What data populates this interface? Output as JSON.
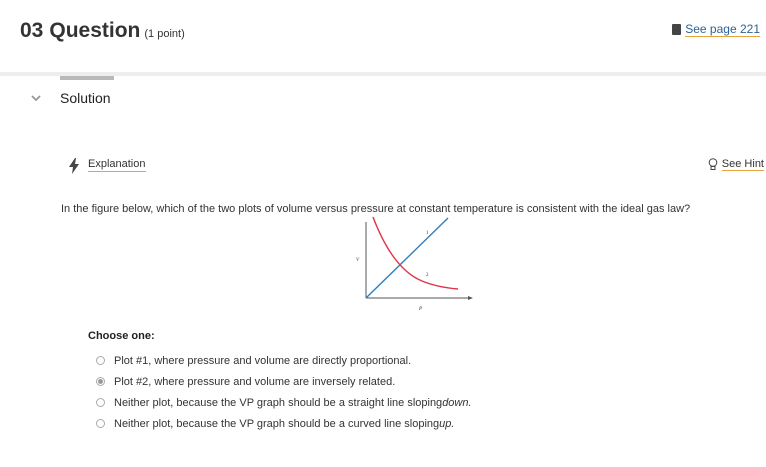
{
  "header": {
    "question_number": "03",
    "question_label": "Question",
    "points": "(1 point)",
    "see_page": "See page 221"
  },
  "solution": {
    "label": "Solution"
  },
  "explanation": {
    "link": "Explanation",
    "hint": "See Hint"
  },
  "question_text": "In the figure below, which of the two plots of volume versus pressure at constant temperature is consistent with the ideal gas law?",
  "figure": {
    "y_axis_label": "V",
    "x_axis_label": "P",
    "line_labels": [
      "1",
      "2"
    ],
    "colors": {
      "plot1": "#2f7fc1",
      "plot2": "#e0344a",
      "axes": "#555555"
    }
  },
  "choices": {
    "prompt": "Choose one:",
    "options": [
      {
        "text": "Plot #1, where pressure and volume are directly proportional.",
        "suffix": "",
        "selected": false
      },
      {
        "text": "Plot #2, where pressure and volume are inversely related.",
        "suffix": "",
        "selected": true
      },
      {
        "text": "Neither plot, because the VP graph should be a straight line sloping ",
        "suffix": "down.",
        "selected": false
      },
      {
        "text": "Neither plot, because the VP graph should be a curved line sloping ",
        "suffix": "up.",
        "selected": false
      }
    ]
  }
}
